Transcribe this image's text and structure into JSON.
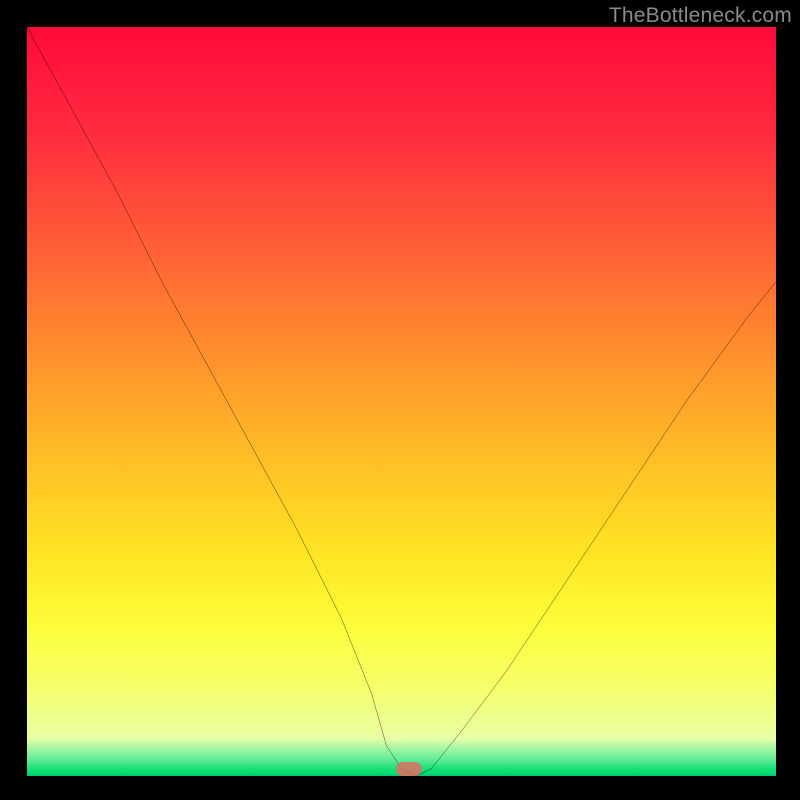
{
  "watermark": "TheBottleneck.com",
  "marker": {
    "x_pct": 51,
    "y_pct": 99
  },
  "chart_data": {
    "type": "line",
    "title": "",
    "xlabel": "",
    "ylabel": "",
    "xlim": [
      0,
      100
    ],
    "ylim": [
      0,
      100
    ],
    "series": [
      {
        "name": "bottleneck-curve",
        "x": [
          0,
          6,
          12,
          18,
          24,
          30,
          36,
          42,
          46,
          48,
          50,
          52,
          54,
          58,
          64,
          72,
          80,
          88,
          96,
          100
        ],
        "y": [
          100,
          89,
          78,
          66,
          55,
          44,
          33,
          21,
          11,
          4,
          1,
          0,
          1,
          6,
          14,
          26,
          38,
          50,
          61,
          66
        ]
      }
    ],
    "annotations": [
      {
        "type": "marker",
        "x": 51,
        "y": 1,
        "shape": "pill",
        "color": "#df6e63"
      }
    ],
    "background_gradient": {
      "direction": "vertical",
      "stops": [
        {
          "pos": 0.0,
          "color": "#ff0a3a"
        },
        {
          "pos": 0.5,
          "color": "#ffb927"
        },
        {
          "pos": 0.8,
          "color": "#fdfd3a"
        },
        {
          "pos": 1.0,
          "color": "#36e07a"
        }
      ]
    }
  }
}
